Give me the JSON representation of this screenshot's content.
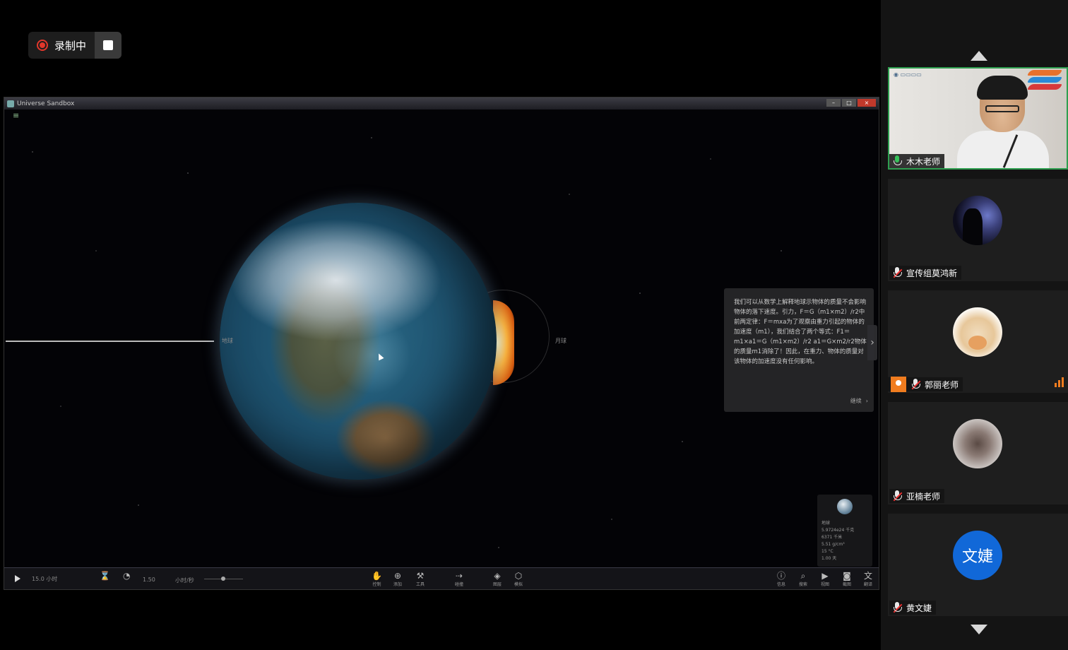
{
  "recording": {
    "label": "录制中",
    "stop_icon": "stop-square-icon",
    "record_icon": "record-dot-icon"
  },
  "shared_window": {
    "title": "Universe Sandbox",
    "fps_label": "30 FPS",
    "tip": {
      "text": "我们可以从数学上解释地球示物体的质量不会影响物体的落下速度。引力，F＝G（m1×m2）/r2中前两定律：F＝mxa为了观察由重力引起的物体的加速度（m1），我们结合了两个等式：F1＝m1×a1＝G（m1×m2）/r2 a1＝G×m2/r2物体的质量m1消除了！因此，在重力、物体的质量对该物体的加速度没有任何影响。",
      "next_label": "继续"
    },
    "object_panel": {
      "name": "地球",
      "lines": [
        "5.9724e24 千克",
        "6371 千米",
        "5.51 g/cm³",
        "15 °C",
        "1.00 天"
      ]
    },
    "toolbar": {
      "time_label": "15.0 小时",
      "speed_value": "1.50",
      "speed_unit": "小时/秒",
      "items": [
        "控制",
        "添加",
        "工具",
        "碰撞",
        "图层",
        "模拟",
        "信息",
        "搜索",
        "视图",
        "截图",
        "翻译"
      ]
    },
    "labels": {
      "left_tag": "地球",
      "right_tag": "月球"
    }
  },
  "participants": [
    {
      "name": "木木老师",
      "mic": "on",
      "video": true
    },
    {
      "name": "宣传组莫鸿新",
      "mic": "muted",
      "avatar_icon": "silhouette-avatar"
    },
    {
      "name": "郭丽老师",
      "mic": "muted",
      "host": true,
      "avatar_icon": "hamster-avatar"
    },
    {
      "name": "亚楠老师",
      "mic": "muted",
      "avatar_icon": "photo-avatar"
    },
    {
      "name": "黄文婕",
      "mic": "muted",
      "avatar_text": "文婕"
    }
  ],
  "colors": {
    "active_border": "#2e9e4f",
    "record_red": "#e3372b",
    "avatar_blue": "#1168d8",
    "host_orange": "#f07c1f"
  }
}
